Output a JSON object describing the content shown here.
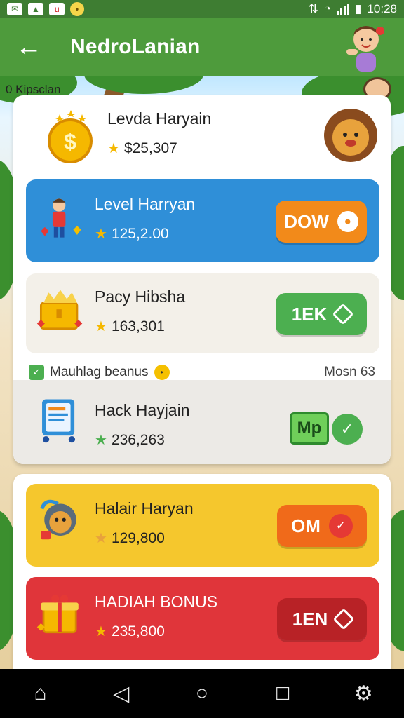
{
  "status_bar": {
    "time": "10:28"
  },
  "app_bar": {
    "title": "NedroLanian"
  },
  "scene": {
    "label": "0 Kipsclan"
  },
  "rows": [
    {
      "title": "Levda Haryain",
      "value": "$25,307"
    },
    {
      "title": "Level Harryan",
      "value": "125,2.00",
      "button": "DOW"
    },
    {
      "title": "Pacy Hibsha",
      "value": "163,301",
      "button": "1EK"
    },
    {
      "title": "Hack Hayjain",
      "value": "236,263",
      "button": "Mp"
    },
    {
      "title": "Halair Haryan",
      "value": "129,800",
      "button": "OM"
    },
    {
      "title": "HADIAH BONUS",
      "value": "235,800",
      "button": "1EN"
    }
  ],
  "section": {
    "left": "Mauhlag beanus",
    "right": "Mosn 63"
  },
  "colors": {
    "green": "#4e9b3c",
    "blue": "#2f8fd8",
    "orange": "#f28a1a",
    "yellow": "#f5c72d",
    "red": "#e0353a",
    "mint": "#4caf50"
  }
}
